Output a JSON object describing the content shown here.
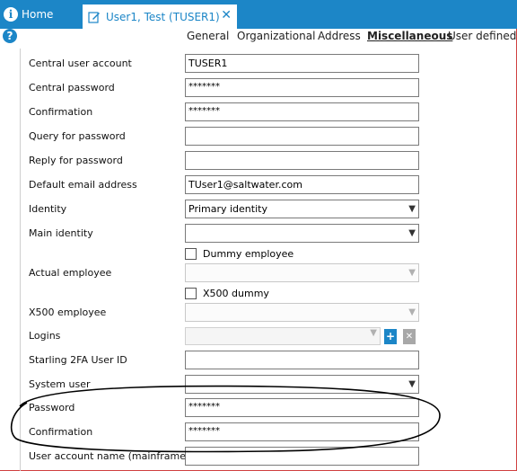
{
  "tabs": {
    "home_label": "Home",
    "active_label": "User1, Test (TUSER1)"
  },
  "subnav": [
    "General",
    "Organizational",
    "Address",
    "Miscellaneous",
    "User defined"
  ],
  "form": {
    "central_user_account": {
      "label": "Central user account",
      "value": "TUSER1"
    },
    "central_password": {
      "label": "Central password",
      "value": "*******"
    },
    "confirmation": {
      "label": "Confirmation",
      "value": "*******"
    },
    "query_for_password": {
      "label": "Query for password",
      "value": ""
    },
    "reply_for_password": {
      "label": "Reply for password",
      "value": ""
    },
    "default_email": {
      "label": "Default email address",
      "value": "TUser1@saltwater.com"
    },
    "identity": {
      "label": "Identity",
      "value": "Primary identity"
    },
    "main_identity": {
      "label": "Main identity",
      "value": ""
    },
    "dummy_employee": {
      "label": "Dummy employee"
    },
    "actual_employee": {
      "label": "Actual employee",
      "value": ""
    },
    "x500_dummy": {
      "label": "X500 dummy"
    },
    "x500_employee": {
      "label": "X500 employee",
      "value": ""
    },
    "logins": {
      "label": "Logins",
      "value": ""
    },
    "starling_2fa": {
      "label": "Starling 2FA User ID",
      "value": ""
    },
    "system_user": {
      "label": "System user",
      "value": ""
    },
    "password": {
      "label": "Password",
      "value": "*******"
    },
    "password_confirmation": {
      "label": "Confirmation",
      "value": "*******"
    },
    "mainframe_account": {
      "label": "User account name (mainframe)",
      "value": ""
    }
  },
  "colors": {
    "accent": "#1c86c7",
    "annotation": "#000000"
  }
}
